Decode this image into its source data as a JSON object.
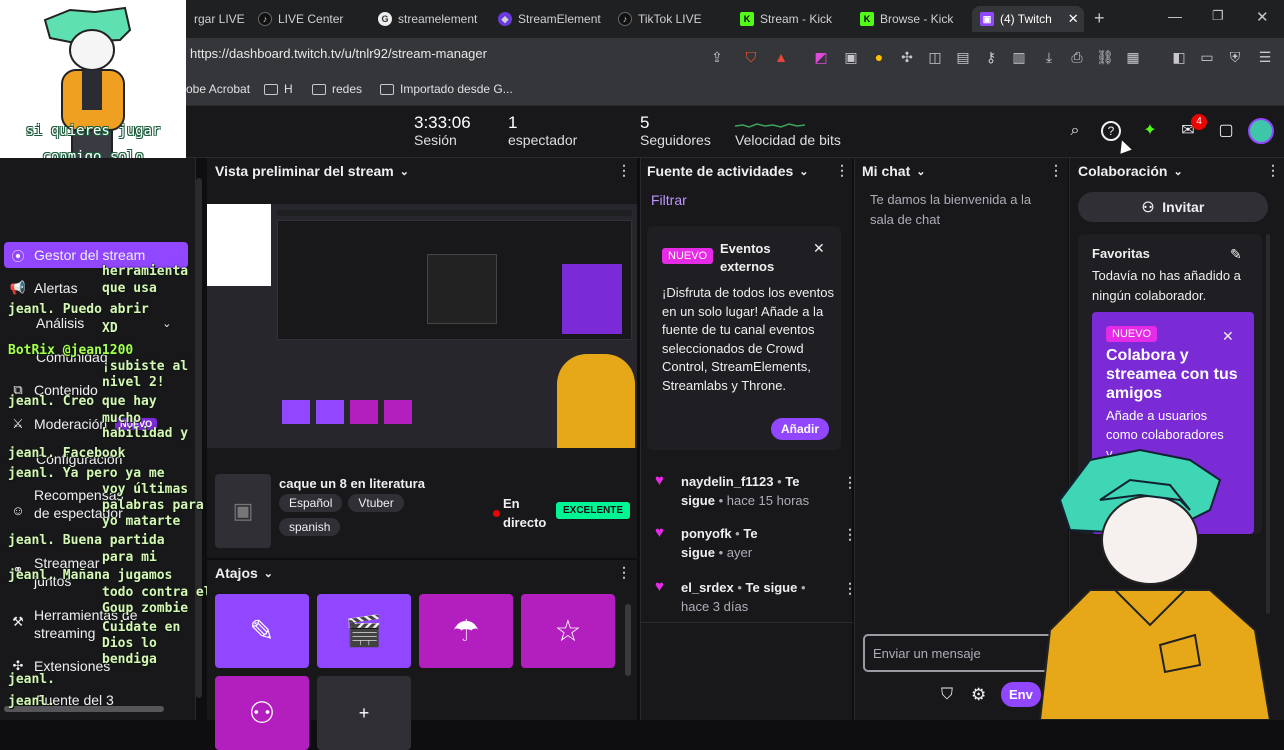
{
  "browser": {
    "tabs": [
      {
        "label": "rgar LIVE",
        "icon": "tab-icon",
        "color": "#a0a0a8"
      },
      {
        "label": "LIVE Center",
        "icon": "tiktok-icon",
        "color": "#000000"
      },
      {
        "label": "streamelement",
        "icon": "chrome-icon",
        "color": "#4285f4"
      },
      {
        "label": "StreamElement",
        "icon": "streamelements-icon",
        "color": "#6a39e0"
      },
      {
        "label": "TikTok LIVE",
        "icon": "tiktok-icon",
        "color": "#000000"
      },
      {
        "label": "Stream - Kick",
        "icon": "kick-icon",
        "color": "#53fc18"
      },
      {
        "label": "Browse - Kick",
        "icon": "kick-icon",
        "color": "#53fc18"
      },
      {
        "label": "(4) Twitch",
        "icon": "twitch-icon",
        "color": "#9146ff"
      }
    ],
    "url": "https://dashboard.twitch.tv/u/tnlr92/stream-manager",
    "bookmarks": [
      "obe Acrobat",
      "H",
      "redes",
      "Importado desde G..."
    ]
  },
  "topbar": {
    "session_time": "3:33:06",
    "session_label": "Sesión",
    "viewers_value": "1",
    "viewers_label": "espectador",
    "followers_value": "5",
    "followers_label": "Seguidores",
    "bits_label": "Velocidad de bits",
    "notifications_count": "4"
  },
  "sidebar": {
    "active_item": "Gestor del stream",
    "items": [
      "Alertas",
      "Análisis",
      "Comunidad",
      "Contenido",
      "Moderación",
      "Configuración",
      "Recompensas de espectador",
      "Streamear juntos",
      "Herramientas de streaming",
      "Extensiones",
      "Fuente del 3"
    ],
    "new_badge": "NUEVO"
  },
  "overlay_chat": {
    "lines": [
      "herramienta",
      "que usa",
      "jeanl. Puedo abrir",
      "XD",
      "BotRix @jean1200",
      "¡subiste al",
      "nivel 2!",
      "jeanl. Creo que hay",
      "mucho",
      "habilidad y",
      "jeanl. Facebook",
      "jeanl. Ya pero ya me",
      "voy últimas",
      "palabras para",
      "yo matarte",
      "jeanl. Buena partida",
      "para mi",
      "jeanl. Mañana jugamos",
      "todo contra el",
      "Goup zombie",
      "Cuidate en",
      "Dios lo",
      "bendiga",
      "jeanl.",
      "jeanl."
    ],
    "webcam_text": "si quieres jugar conmigo solo escribenos"
  },
  "preview": {
    "title": "Vista preliminar del stream",
    "stream_title": "caque un 8 en literatura",
    "tags": [
      "Español",
      "Vtuber",
      "spanish"
    ],
    "status": "En directo",
    "quality": "EXCELENTE"
  },
  "shortcuts": {
    "title": "Atajos",
    "add_label": "+",
    "colors": [
      "#9146ff",
      "#9146ff",
      "#b31fbf",
      "#b31fbf",
      "#b31fbf"
    ]
  },
  "activity": {
    "title": "Fuente de actividades",
    "filter": "Filtrar",
    "promo_badge": "NUEVO",
    "promo_title": "Eventos externos",
    "promo_body": "¡Disfruta de todos los eventos en un solo lugar! Añade a la fuente de tu canal eventos seleccionados de Crowd Control, StreamElements, Streamlabs y Throne.",
    "promo_button": "Añadir",
    "events": [
      {
        "name": "naydelin_f1123",
        "action": "Te sigue",
        "time": "hace 15 horas"
      },
      {
        "name": "ponyofk",
        "action": "Te sigue",
        "time": "ayer"
      },
      {
        "name": "el_srdex",
        "action": "Te sigue",
        "time": "hace 3 días"
      }
    ]
  },
  "chat": {
    "title": "Mi chat",
    "welcome": "Te damos la bienvenida a la sala de chat",
    "placeholder": "Enviar un mensaje",
    "send": "Env"
  },
  "collab": {
    "title": "Colaboración",
    "invite": "Invitar",
    "favorites_title": "Favoritas",
    "favorites_empty": "Todavía no has añadido a ningún colaborador.",
    "promo_badge": "NUEVO",
    "promo_title": "Colabora y streamea con tus amigos",
    "promo_body": "Añade a usuarios como colaboradores y"
  },
  "accent": "#9146ff"
}
